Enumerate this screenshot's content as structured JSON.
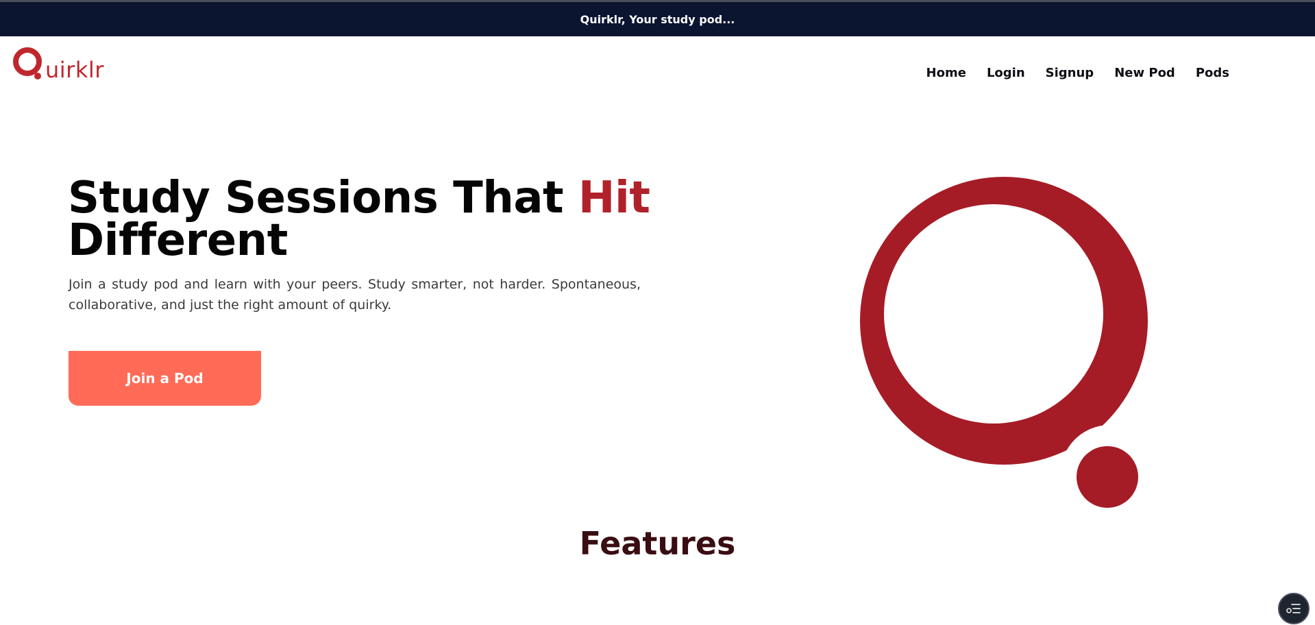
{
  "announcement": {
    "text": "Quirklr, Your study pod..."
  },
  "brand": {
    "logo_text": "uirklr",
    "accent_color": "#b0222a"
  },
  "nav": {
    "items": [
      {
        "label": "Home"
      },
      {
        "label": "Login"
      },
      {
        "label": "Signup"
      },
      {
        "label": "New Pod"
      },
      {
        "label": "Pods"
      }
    ]
  },
  "hero": {
    "title_start": "Study Sessions That ",
    "title_accent": "Hit",
    "title_end": "Different",
    "description": "Join a study pod and learn with your peers. Study smarter, not harder. Spontaneous, collaborative, and just the right amount of quirky.",
    "cta_label": "Join a Pod",
    "cta_color": "#ff6b57"
  },
  "features": {
    "heading": "Features"
  },
  "colors": {
    "header_bg": "#0b1530",
    "features_heading": "#3a0d12"
  },
  "fab": {
    "icon": "list-settings-icon"
  }
}
